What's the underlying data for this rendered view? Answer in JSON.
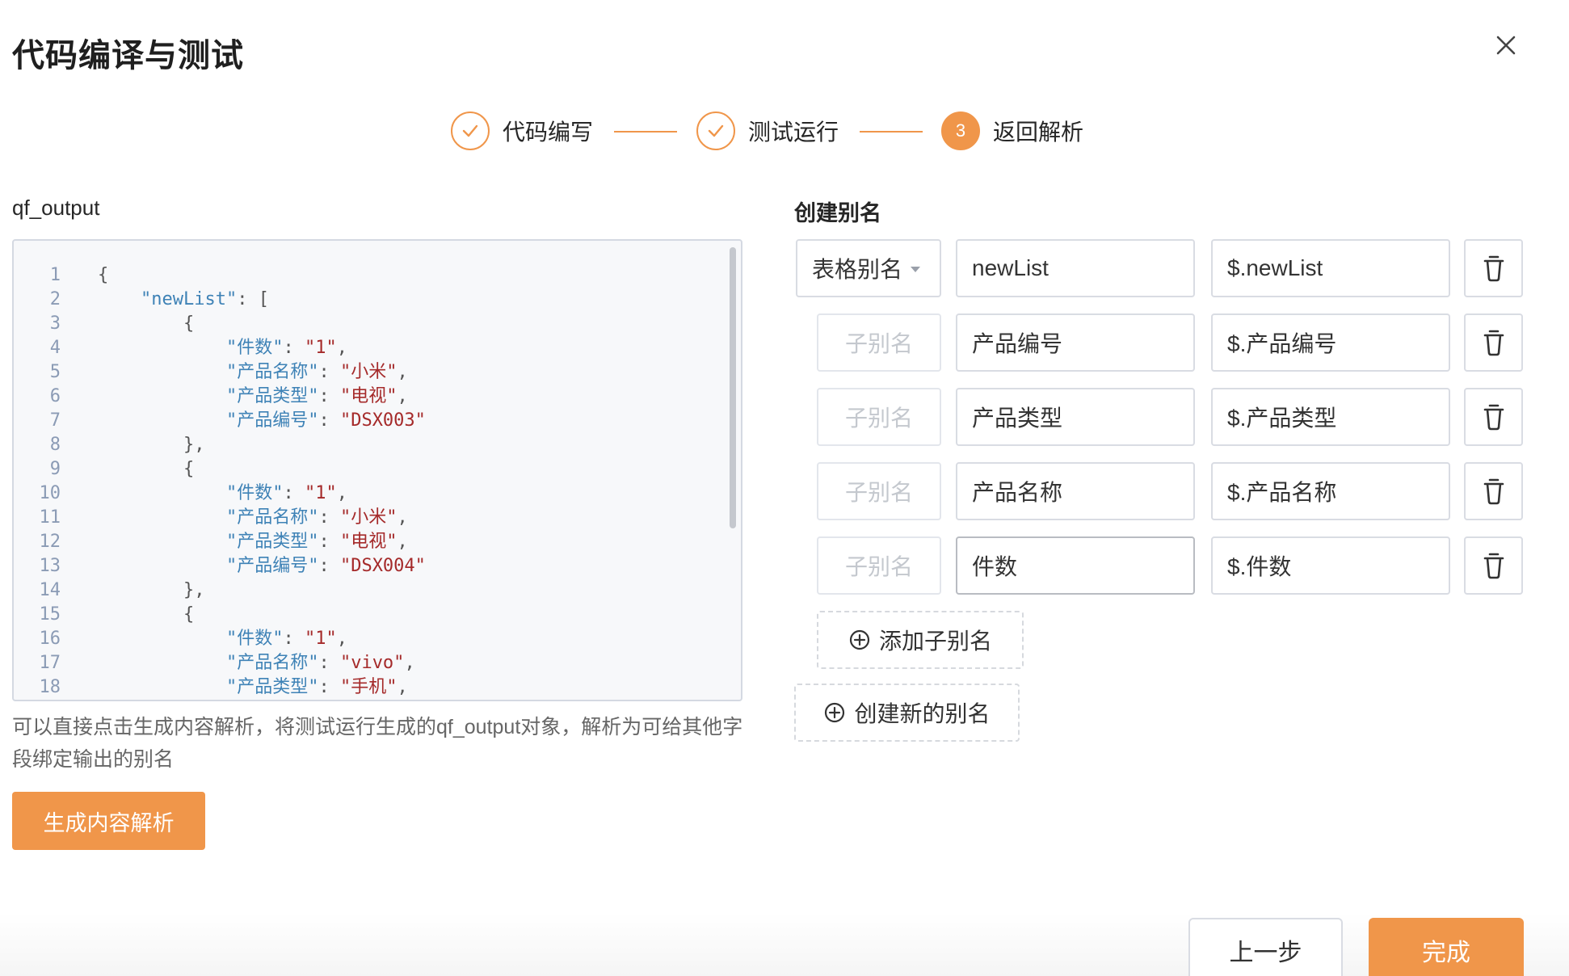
{
  "dialog": {
    "title": "代码编译与测试"
  },
  "steps": [
    {
      "label": "代码编写",
      "state": "done"
    },
    {
      "label": "测试运行",
      "state": "done"
    },
    {
      "label": "返回解析",
      "state": "active",
      "number": "3"
    }
  ],
  "left": {
    "field_label": "qf_output",
    "code_lines": [
      {
        "n": "1"
      },
      {
        "n": "2"
      },
      {
        "n": "3"
      },
      {
        "n": "4"
      },
      {
        "n": "5"
      },
      {
        "n": "6"
      },
      {
        "n": "7"
      },
      {
        "n": "8"
      },
      {
        "n": "9"
      },
      {
        "n": "10"
      },
      {
        "n": "11"
      },
      {
        "n": "12"
      },
      {
        "n": "13"
      },
      {
        "n": "14"
      },
      {
        "n": "15"
      },
      {
        "n": "16"
      },
      {
        "n": "17"
      },
      {
        "n": "18"
      }
    ],
    "code": {
      "l1": "{",
      "l2_key": "\"newList\"",
      "l2_rest": ": [",
      "l3": "{",
      "k_count": "\"件数\"",
      "k_name": "\"产品名称\"",
      "k_type": "\"产品类型\"",
      "k_code": "\"产品编号\"",
      "v1": "\"1\"",
      "v_xiaomi": "\"小米\"",
      "v_tv": "\"电视\"",
      "v_dsx003": "\"DSX003\"",
      "v_dsx004": "\"DSX004\"",
      "v_vivo": "\"vivo\"",
      "v_phone": "\"手机\"",
      "close_comma": "},",
      "open": "{"
    },
    "hint": "可以直接点击生成内容解析，将测试运行生成的qf_output对象，解析为可给其他字段绑定输出的别名",
    "generate_button": "生成内容解析"
  },
  "right": {
    "title": "创建别名",
    "table_alias_select": "表格别名",
    "sub_alias_placeholder": "子别名",
    "rows": [
      {
        "name": "newList",
        "path": "$.newList"
      },
      {
        "name": "产品编号",
        "path": "$.产品编号"
      },
      {
        "name": "产品类型",
        "path": "$.产品类型"
      },
      {
        "name": "产品名称",
        "path": "$.产品名称"
      },
      {
        "name": "件数",
        "path": "$.件数"
      }
    ],
    "add_sub_alias": "添加子别名",
    "create_alias": "创建新的别名"
  },
  "footer": {
    "prev": "上一步",
    "done": "完成"
  },
  "colors": {
    "accent": "#f0964a",
    "key": "#3e82b6",
    "string": "#a52a2a"
  },
  "icons": {
    "close": "close-icon",
    "check": "check-icon",
    "delete": "trash-icon",
    "add": "plus-circle-icon",
    "dropdown": "caret-down-icon"
  }
}
